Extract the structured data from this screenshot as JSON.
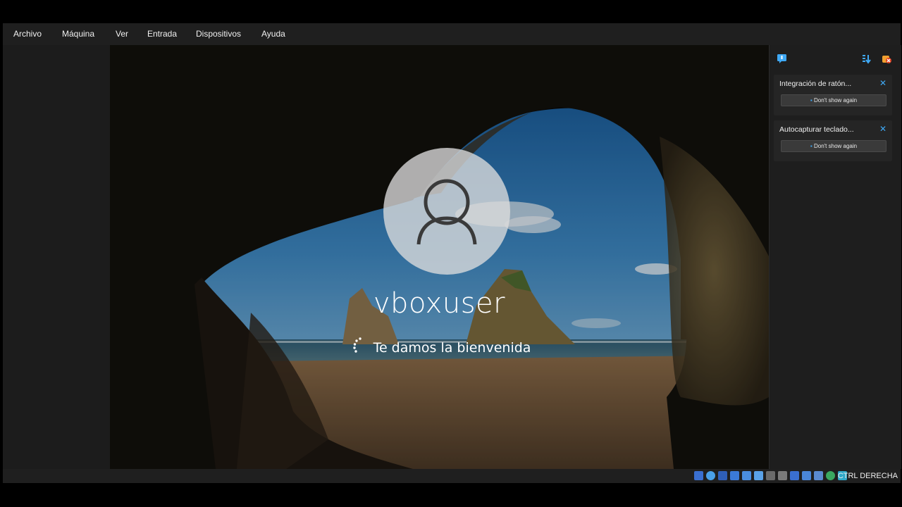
{
  "menu": {
    "items": [
      {
        "label": "Archivo"
      },
      {
        "label": "Máquina"
      },
      {
        "label": "Ver"
      },
      {
        "label": "Entrada"
      },
      {
        "label": "Dispositivos"
      },
      {
        "label": "Ayuda"
      }
    ]
  },
  "login": {
    "username": "vboxuser",
    "welcome": "Te damos la bienvenida",
    "avatar_icon": "user-icon",
    "spinner_icon": "loading-spinner-icon"
  },
  "notifications": {
    "items": [
      {
        "title": "Integración de ratón...",
        "button_label": "Don't show again"
      },
      {
        "title": "Autocapturar teclado...",
        "button_label": "Don't show again"
      }
    ],
    "accent_color": "#3fa9f5"
  },
  "statusbar": {
    "host_key": "CTRL DERECHA",
    "icons": [
      "hard-disk-icon",
      "optical-drive-icon",
      "floppy-icon",
      "audio-icon",
      "network-icon",
      "usb-icon",
      "shared-folders-icon",
      "display-icon",
      "screen-capture-icon",
      "recording-icon",
      "cpu-icon",
      "mouse-integration-icon",
      "keyboard-icon"
    ]
  }
}
